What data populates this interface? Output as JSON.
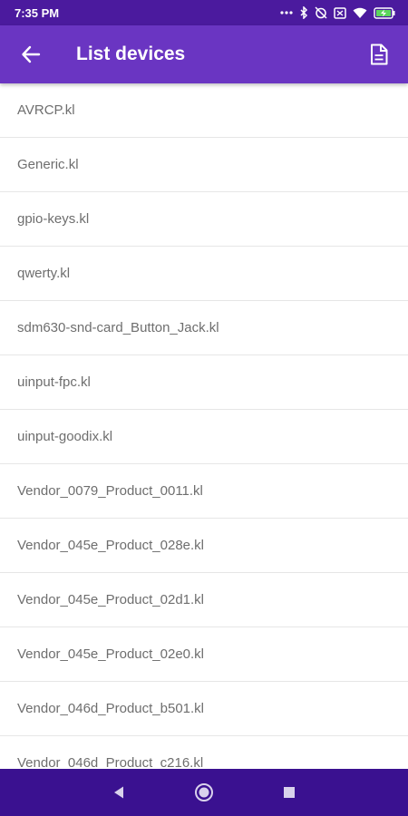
{
  "status_bar": {
    "time": "7:35 PM",
    "icons": [
      "more-dots-icon",
      "bluetooth-icon",
      "alarm-off-icon",
      "screen-box-icon",
      "wifi-icon",
      "battery-charging-icon"
    ]
  },
  "app_bar": {
    "title": "List devices",
    "back_icon": "arrow-back-icon",
    "action_icon": "document-icon"
  },
  "devices": [
    "AVRCP.kl",
    "Generic.kl",
    "gpio-keys.kl",
    "qwerty.kl",
    "sdm630-snd-card_Button_Jack.kl",
    "uinput-fpc.kl",
    "uinput-goodix.kl",
    "Vendor_0079_Product_0011.kl",
    "Vendor_045e_Product_028e.kl",
    "Vendor_045e_Product_02d1.kl",
    "Vendor_045e_Product_02e0.kl",
    "Vendor_046d_Product_b501.kl",
    "Vendor_046d_Product_c216.kl"
  ],
  "nav_bar": {
    "buttons": [
      "back-triangle-icon",
      "home-circle-icon",
      "recents-square-icon"
    ]
  },
  "colors": {
    "status_bar": "#4b1a9e",
    "app_bar": "#6a35c2",
    "nav_bar": "#3a1190",
    "item_text": "#6e6e6e",
    "divider": "#e6e6e6"
  }
}
